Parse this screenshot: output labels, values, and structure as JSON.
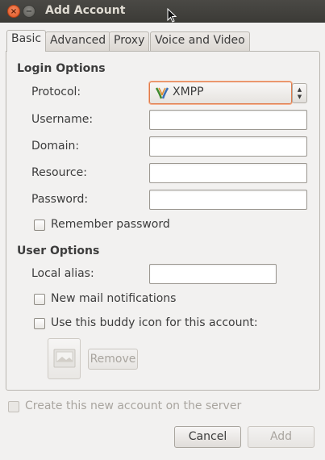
{
  "window": {
    "title": "Add Account",
    "close_glyph": "×",
    "minimize_glyph": "−"
  },
  "tabs": [
    {
      "label": "Basic",
      "active": true
    },
    {
      "label": "Advanced",
      "active": false
    },
    {
      "label": "Proxy",
      "active": false
    },
    {
      "label": "Voice and Video",
      "active": false
    }
  ],
  "login_options": {
    "heading": "Login Options",
    "protocol_label": "Protocol:",
    "protocol_value": "XMPP",
    "protocol_icon": "xmpp-icon",
    "username_label": "Username:",
    "username_value": "",
    "domain_label": "Domain:",
    "domain_value": "",
    "resource_label": "Resource:",
    "resource_value": "",
    "password_label": "Password:",
    "password_value": "",
    "remember_password": {
      "label": "Remember password",
      "checked": false
    }
  },
  "user_options": {
    "heading": "User Options",
    "local_alias_label": "Local alias:",
    "local_alias_value": "",
    "new_mail": {
      "label": "New mail notifications",
      "checked": false
    },
    "buddy_icon": {
      "label": "Use this buddy icon for this account:",
      "checked": false
    },
    "buddy_icon_button": "image-placeholder-icon",
    "remove_button": "Remove"
  },
  "create_account": {
    "label": "Create this new account on the server",
    "checked": false,
    "enabled": false
  },
  "buttons": {
    "cancel": "Cancel",
    "add": "Add"
  },
  "colors": {
    "focus_accent": "#e07a4a",
    "titlebar": "#3c3b37",
    "window_bg": "#f2f1f0"
  }
}
